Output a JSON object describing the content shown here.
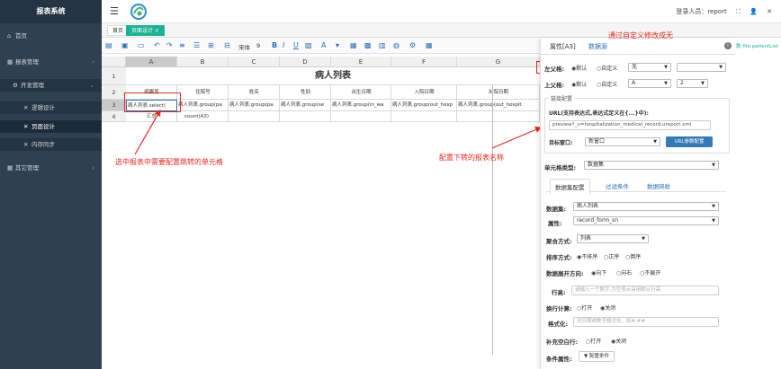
{
  "app": {
    "title": "报表系统",
    "user_text": "登录人员：report"
  },
  "sidebar": {
    "items": [
      {
        "label": "首页",
        "icon": "home-icon"
      },
      {
        "label": "报表管理",
        "icon": "grid-icon"
      },
      {
        "label": "开发管理",
        "icon": "gear-icon"
      },
      {
        "label": "逻辑设计",
        "icon": "tool-icon"
      },
      {
        "label": "页面设计",
        "icon": "tool-icon"
      },
      {
        "label": "内存同步",
        "icon": "tool-icon"
      },
      {
        "label": "其它管理",
        "icon": "grid-icon"
      }
    ]
  },
  "tabs": [
    {
      "label": "首页"
    },
    {
      "label": "页面设计 ×"
    }
  ],
  "toolbar": {
    "font_name": "宋体",
    "font_size": "9"
  },
  "sheet": {
    "columns": [
      "A",
      "B",
      "C",
      "D",
      "E",
      "F",
      "G"
    ],
    "rows": [
      "1",
      "2",
      "3",
      "4"
    ],
    "title": "病人列表",
    "headers": [
      "病案号",
      "住院号",
      "姓名",
      "性别",
      "出生日期",
      "入院日期",
      "出院日期"
    ],
    "row3": [
      "病人列表.select(",
      "病人列表.group(pa",
      "病人列表.group(pa",
      "病人列表.group(se",
      "病人列表.group(in_wa",
      "病人列表.group(out_hosp",
      "病人列表.group(out_hospit"
    ],
    "row4": [
      "汇总",
      "count(A3)"
    ]
  },
  "annotations": {
    "top": "通过自定义修改成无",
    "left": "选中报表中需要配置跳转的单元格",
    "middle": "配置下转的报表名称"
  },
  "panel": {
    "tab_props": "属性[A3]",
    "tab_datasource": "数据源",
    "left_parent_label": "左父格:",
    "top_parent_label": "上父格:",
    "radio_default": "默认",
    "radio_custom": "自定义",
    "left_parent_value": "无",
    "top_parent_value": "A",
    "top_parent_row": "2",
    "link_legend": "链接配置",
    "url_label": "URL(支持表达式,表达式定义在{...}中):",
    "url_value": "preview?_u=hospitalization_medical_record.ureport.xml",
    "target_label": "目标窗口:",
    "target_value": "新窗口",
    "url_param_button": "URL参数配置",
    "cell_type_label": "单元格类型:",
    "cell_type_value": "数据集",
    "subtab_dataset": "数据集配置",
    "subtab_filter": "过滤条件",
    "subtab_mapping": "数据映射",
    "dataset_label": "数据集:",
    "dataset_value": "病人列表",
    "property_label": "属性:",
    "property_value": "record_form_sn",
    "aggregate_label": "聚合方式:",
    "aggregate_value": "列表",
    "sort_label": "排序方式:",
    "sort_none": "不排序",
    "sort_asc": "正序",
    "sort_desc": "倒序",
    "expand_label": "数据展开方向:",
    "expand_down": "向下",
    "expand_right": "向右",
    "expand_none": "不展开",
    "rowheight_label": "行高:",
    "rowheight_placeholder": "请输入一个数字,为空表示采用默认行高",
    "wrap_label": "换行计算:",
    "wrap_on": "打开",
    "wrap_off": "关闭",
    "format_label": "格式化:",
    "format_placeholder": "对日期或数字格式化，如#.##",
    "fill_label": "补充空白行:",
    "fill_on": "打开",
    "fill_off": "关闭",
    "condition_label": "条件属性:",
    "condition_button": "配置条件"
  },
  "right_strip": {
    "text": "数:file:patientList"
  }
}
